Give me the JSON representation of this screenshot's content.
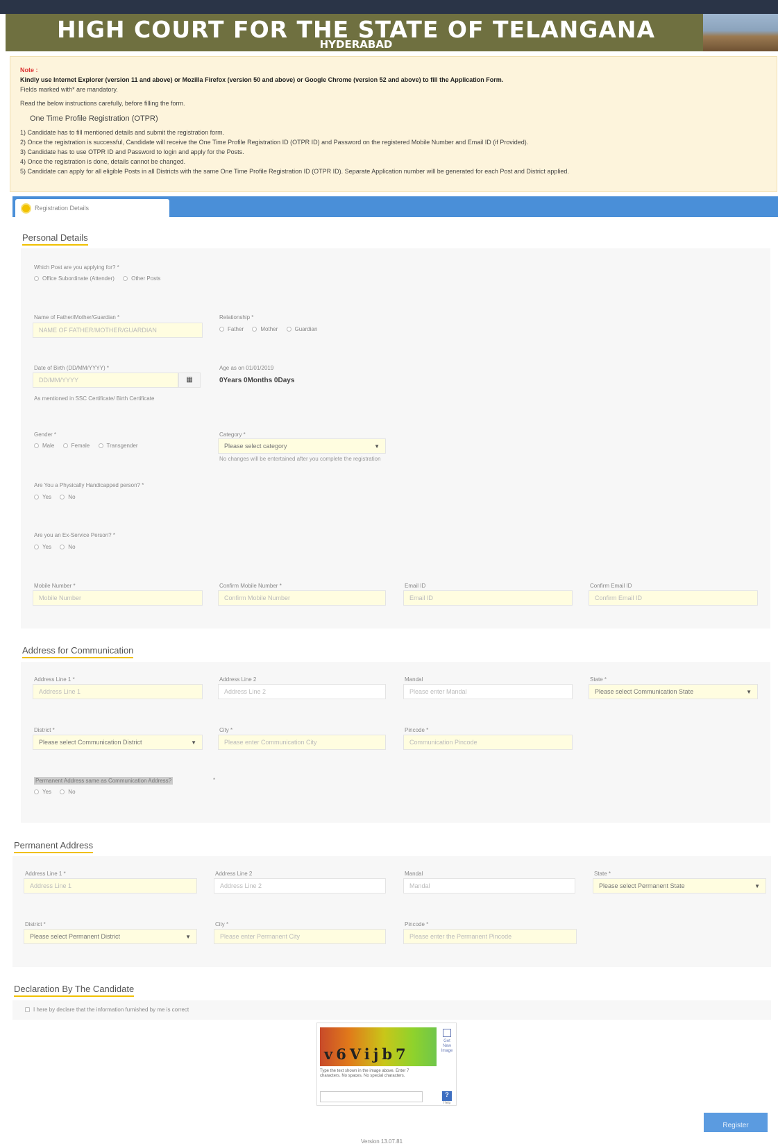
{
  "header": {
    "title": "HIGH COURT FOR THE STATE OF TELANGANA",
    "subtitle": "HYDERABAD"
  },
  "note": {
    "heading": "Note :",
    "browser_notice": "Kindly use Internet Explorer (version 11 and above) or Mozilla Firefox (version 50 and above) or Google Chrome (version 52 and above) to fill the Application Form.",
    "mandatory": "Fields marked with* are mandatory.",
    "read_instructions": "Read the below instructions carefully, before filling the form.",
    "otpr_title": "One Time Profile Registration (OTPR)",
    "points": [
      "1) Candidate has to fill mentioned details and submit the registration form.",
      "2) Once the registration is successful, Candidate will receive the One Time Profile Registration ID (OTPR ID) and Password on the registered Mobile Number and Email ID (if Provided).",
      "3) Candidate has to use OTPR ID and Password to login and apply for the Posts.",
      "4) Once the registration is done, details cannot be changed.",
      "5) Candidate can apply for all eligible Posts in all Districts with the same One Time Profile Registration ID (OTPR ID). Separate Application number will be generated for each Post and District applied."
    ]
  },
  "tabs": [
    {
      "label": "Registration Details"
    }
  ],
  "personal": {
    "section_title": "Personal Details",
    "post_question": "Which Post are you applying for? *",
    "post_options": [
      "Office Subordinate (Attender)",
      "Other Posts"
    ],
    "guardian_label": "Name of Father/Mother/Guardian *",
    "guardian_placeholder": "NAME OF FATHER/MOTHER/GUARDIAN",
    "relationship_label": "Relationship *",
    "relationship_options": [
      "Father",
      "Mother",
      "Guardian"
    ],
    "dob_label": "Date of Birth (DD/MM/YYYY) *",
    "dob_placeholder": "DD/MM/YYYY",
    "calendar_icon": "calendar-icon",
    "dob_hint": "As mentioned in SSC Certificate/ Birth Certificate",
    "age_label": "Age as on 01/01/2019",
    "age_value": "0Years 0Months 0Days",
    "gender_label": "Gender *",
    "gender_options": [
      "Male",
      "Female",
      "Transgender"
    ],
    "category_label": "Category *",
    "category_value": "Please select category",
    "category_hint": "No changes will be entertained after you complete the registration",
    "ph_label": "Are You a Physically Handicapped person? *",
    "ph_options": [
      "Yes",
      "No"
    ],
    "exs_label": "Are you an Ex-Service Person? *",
    "exs_options": [
      "Yes",
      "No"
    ],
    "mobile_label": "Mobile Number *",
    "mobile_placeholder": "Mobile Number",
    "confirm_mobile_label": "Confirm Mobile Number *",
    "confirm_mobile_placeholder": "Confirm Mobile Number",
    "email_label": "Email ID",
    "email_placeholder": "Email ID",
    "confirm_email_label": "Confirm Email ID",
    "confirm_email_placeholder": "Confirm Email ID"
  },
  "communication": {
    "section_title": "Address for Communication",
    "line1_label": "Address Line 1 *",
    "line1_placeholder": "Address Line 1",
    "line2_label": "Address Line 2",
    "line2_placeholder": "Address Line 2",
    "mandal_label": "Mandal",
    "mandal_placeholder": "Please enter Mandal",
    "state_label": "State *",
    "state_value": "Please select Communication State",
    "district_label": "District *",
    "district_value": "Please select Communication District",
    "city_label": "City *",
    "city_placeholder": "Please enter Communication City",
    "pincode_label": "Pincode *",
    "pincode_placeholder": "Communication Pincode",
    "same_label": "Permanent Address same as Communication Address?",
    "same_star": "*",
    "same_options": [
      "Yes",
      "No"
    ]
  },
  "permanent": {
    "section_title": "Permanent Address",
    "line1_label": "Address Line 1 *",
    "line1_placeholder": "Address Line 1",
    "line2_label": "Address Line 2",
    "line2_placeholder": "Address Line 2",
    "mandal_label": "Mandal",
    "mandal_placeholder": "Mandal",
    "state_label": "State *",
    "state_value": "Please select Permanent State",
    "district_label": "District *",
    "district_value": "Please select Permanent District",
    "city_label": "City *",
    "city_placeholder": "Please enter Permanent City",
    "pincode_label": "Pincode *",
    "pincode_placeholder": "Please enter the Permanent Pincode"
  },
  "declaration": {
    "section_title": "Declaration By The Candidate",
    "text": "I here by declare that the information furnished by me is correct"
  },
  "captcha": {
    "text": "v6Vijb7",
    "side_label": "Get New Image",
    "help_text": "Type the text shown in the image above. Enter 7 characters. No spaces. No special characters.",
    "help_icon": "?",
    "help_caption": "Help"
  },
  "buttons": {
    "register": "Register"
  },
  "footer": {
    "version": "Version 13.07.81"
  }
}
